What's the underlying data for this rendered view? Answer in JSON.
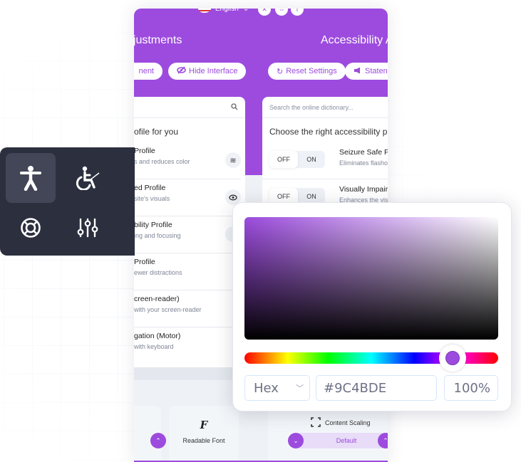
{
  "header": {
    "language": "English",
    "title_left": "djustments",
    "title_right": "Accessibility A",
    "buttons": {
      "statement_partial": "nent",
      "hide_interface": "Hide Interface",
      "reset_settings": "Reset Settings",
      "statement": "Staten"
    }
  },
  "left_card": {
    "section_title": "ofile for you",
    "profiles": [
      {
        "name": "Profile",
        "desc": "s and reduces color",
        "icon": "waves-icon"
      },
      {
        "name": "ed Profile",
        "desc": "site's visuals",
        "icon": "eye-icon"
      },
      {
        "name": "bility Profile",
        "desc": "ing and focusing",
        "icon": "target-icon"
      },
      {
        "name": " Profile",
        "desc": "ewer distractions",
        "icon": ""
      },
      {
        "name": "creen-reader)",
        "desc": "with your screen-reader",
        "icon": ""
      },
      {
        "name": "gation (Motor)",
        "desc": "with keyboard",
        "icon": ""
      }
    ]
  },
  "right_card": {
    "search_placeholder": "Search the online dictionary...",
    "section_title": "Choose the right accessibility pro",
    "toggles": [
      {
        "off_label": "OFF",
        "on_label": "ON",
        "name": "Seizure Safe P",
        "desc": "Eliminates flasho",
        "state": "off"
      },
      {
        "off_label": "OFF",
        "on_label": "ON",
        "name": "Visually Impair",
        "desc": "Enhances the visu",
        "state": "off"
      }
    ]
  },
  "tiles": {
    "readable_font": {
      "glyph": "F",
      "label": "Readable Font"
    },
    "content_scaling": {
      "label": "Content Scaling",
      "value": "Default"
    }
  },
  "dock": {
    "items": [
      {
        "name": "accessibility",
        "active": true
      },
      {
        "name": "wheelchair",
        "active": false
      },
      {
        "name": "lifebuoy",
        "active": false
      },
      {
        "name": "sliders",
        "active": false
      }
    ]
  },
  "color_picker": {
    "mode": "Hex",
    "hex_value": "#9C4BDE",
    "alpha": "100%",
    "hue_position_fraction": 0.82,
    "selected_color": "#9c4bde"
  },
  "colors": {
    "brand": "#9c4bde",
    "dock_bg": "#2b2f3e"
  }
}
